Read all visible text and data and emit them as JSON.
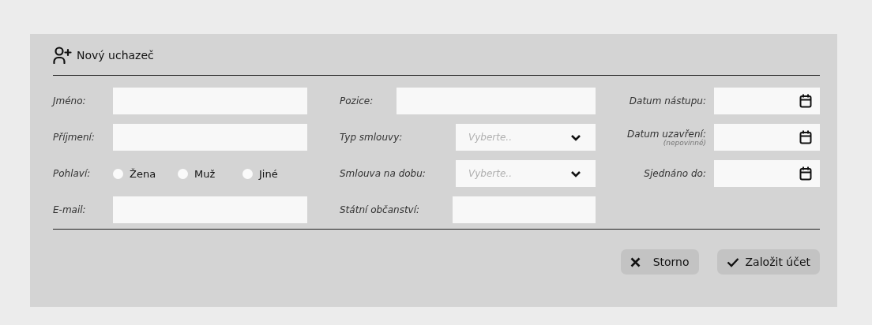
{
  "title": "Nový uchazeč",
  "columns": [
    {
      "rows": [
        {
          "kind": "text",
          "label": "Jméno:"
        },
        {
          "kind": "text",
          "label": "Příjmení:"
        },
        {
          "kind": "radio",
          "label": "Pohlaví:",
          "options": [
            {
              "label": "Žena",
              "selected": false
            },
            {
              "label": "Muž",
              "selected": false
            },
            {
              "label": "Jiné",
              "selected": false
            }
          ]
        },
        {
          "kind": "text",
          "label": "E-mail:"
        }
      ]
    },
    {
      "rows": [
        {
          "kind": "text",
          "label": "Pozice:"
        },
        {
          "kind": "select",
          "label": "Typ smlouvy:",
          "placeholder": "Vyberte.."
        },
        {
          "kind": "select",
          "label": "Smlouva na dobu:",
          "placeholder": "Vyberte.."
        },
        {
          "kind": "short",
          "label": "Státní občanství:"
        }
      ]
    },
    {
      "rows": [
        {
          "kind": "date",
          "label": "Datum nástupu:"
        },
        {
          "kind": "date",
          "label": "Datum uzavření:",
          "note": "(nepovinné)"
        },
        {
          "kind": "date",
          "label": "Sjednáno do:"
        }
      ]
    }
  ],
  "buttons": [
    {
      "kind": "cancel",
      "label": "Storno"
    },
    {
      "kind": "confirm",
      "label": "Založit účet"
    }
  ]
}
